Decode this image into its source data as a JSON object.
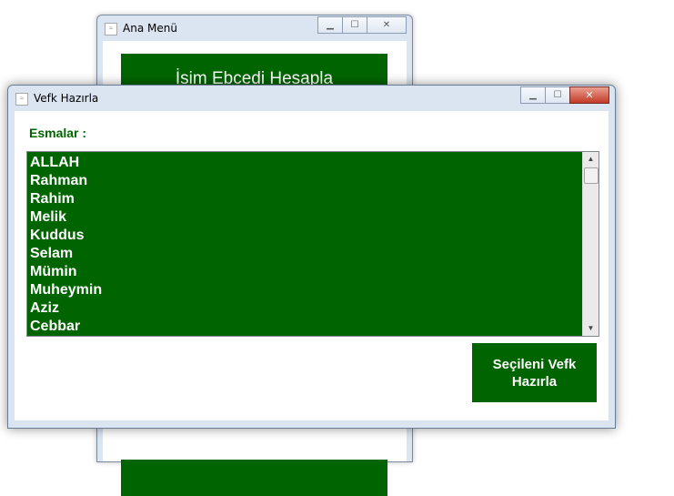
{
  "back_window": {
    "title": "Ana Menü",
    "controls": {
      "minimize": "▁",
      "maximize": "☐",
      "close": "✕"
    },
    "ebced_button_label": "İsim Ebcedi Hesapla"
  },
  "front_window": {
    "title": "Vefk Hazırla",
    "controls": {
      "minimize": "▁",
      "maximize": "☐",
      "close": "✕"
    },
    "esmalar_label": "Esmalar :",
    "esmalar_list": [
      "ALLAH",
      "Rahman",
      "Rahim",
      "Melik",
      "Kuddus",
      "Selam",
      "Mümin",
      "Muheymin",
      "Aziz",
      "Cebbar"
    ],
    "vefk_button_label": "Seçileni Vefk Hazırla"
  },
  "colors": {
    "accent_green": "#006400"
  }
}
